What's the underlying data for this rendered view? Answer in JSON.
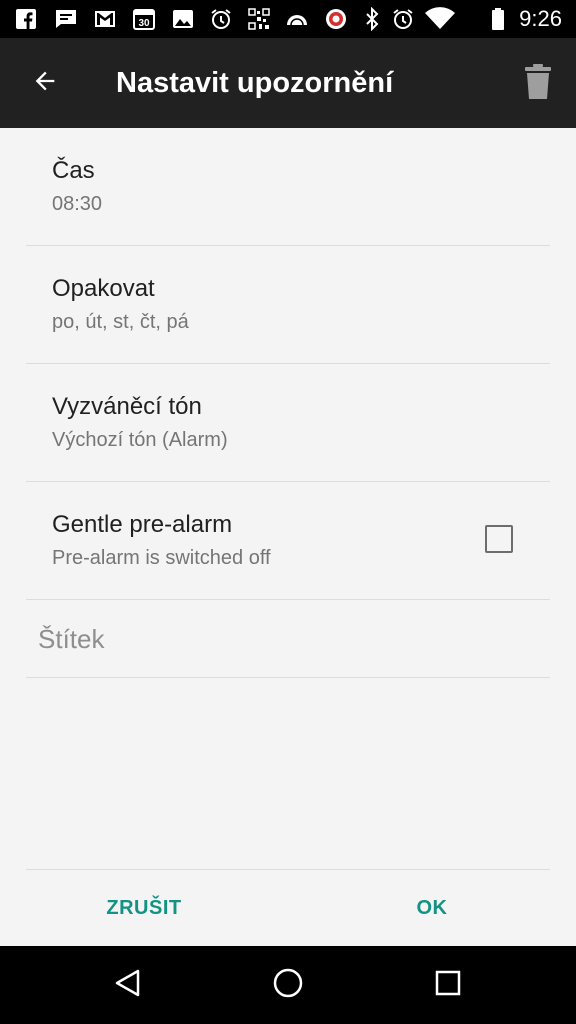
{
  "status_bar": {
    "time": "9:26",
    "left_icons": [
      "facebook-icon",
      "message-icon",
      "gmail-icon",
      "calendar-icon",
      "image-icon",
      "alarm-icon",
      "barcode-icon",
      "weather-icon",
      "app-icon"
    ],
    "calendar_day": "30",
    "right_icons": [
      "bluetooth-icon",
      "alarm-icon",
      "wifi-icon",
      "battery-icon"
    ]
  },
  "app_bar": {
    "title": "Nastavit upozornění"
  },
  "preferences": [
    {
      "title": "Čas",
      "summary": "08:30"
    },
    {
      "title": "Opakovat",
      "summary": "po, út, st, čt, pá"
    },
    {
      "title": "Vyzváněcí tón",
      "summary": "Výchozí tón (Alarm)"
    },
    {
      "title": "Gentle pre-alarm",
      "summary": "Pre-alarm is switched off",
      "checked": false
    }
  ],
  "label_field": {
    "placeholder": "Štítek"
  },
  "actions": {
    "cancel": "ZRUŠIT",
    "ok": "OK"
  },
  "colors": {
    "accent": "#129384",
    "app_bar": "#212121",
    "background": "#f4f4f4"
  }
}
